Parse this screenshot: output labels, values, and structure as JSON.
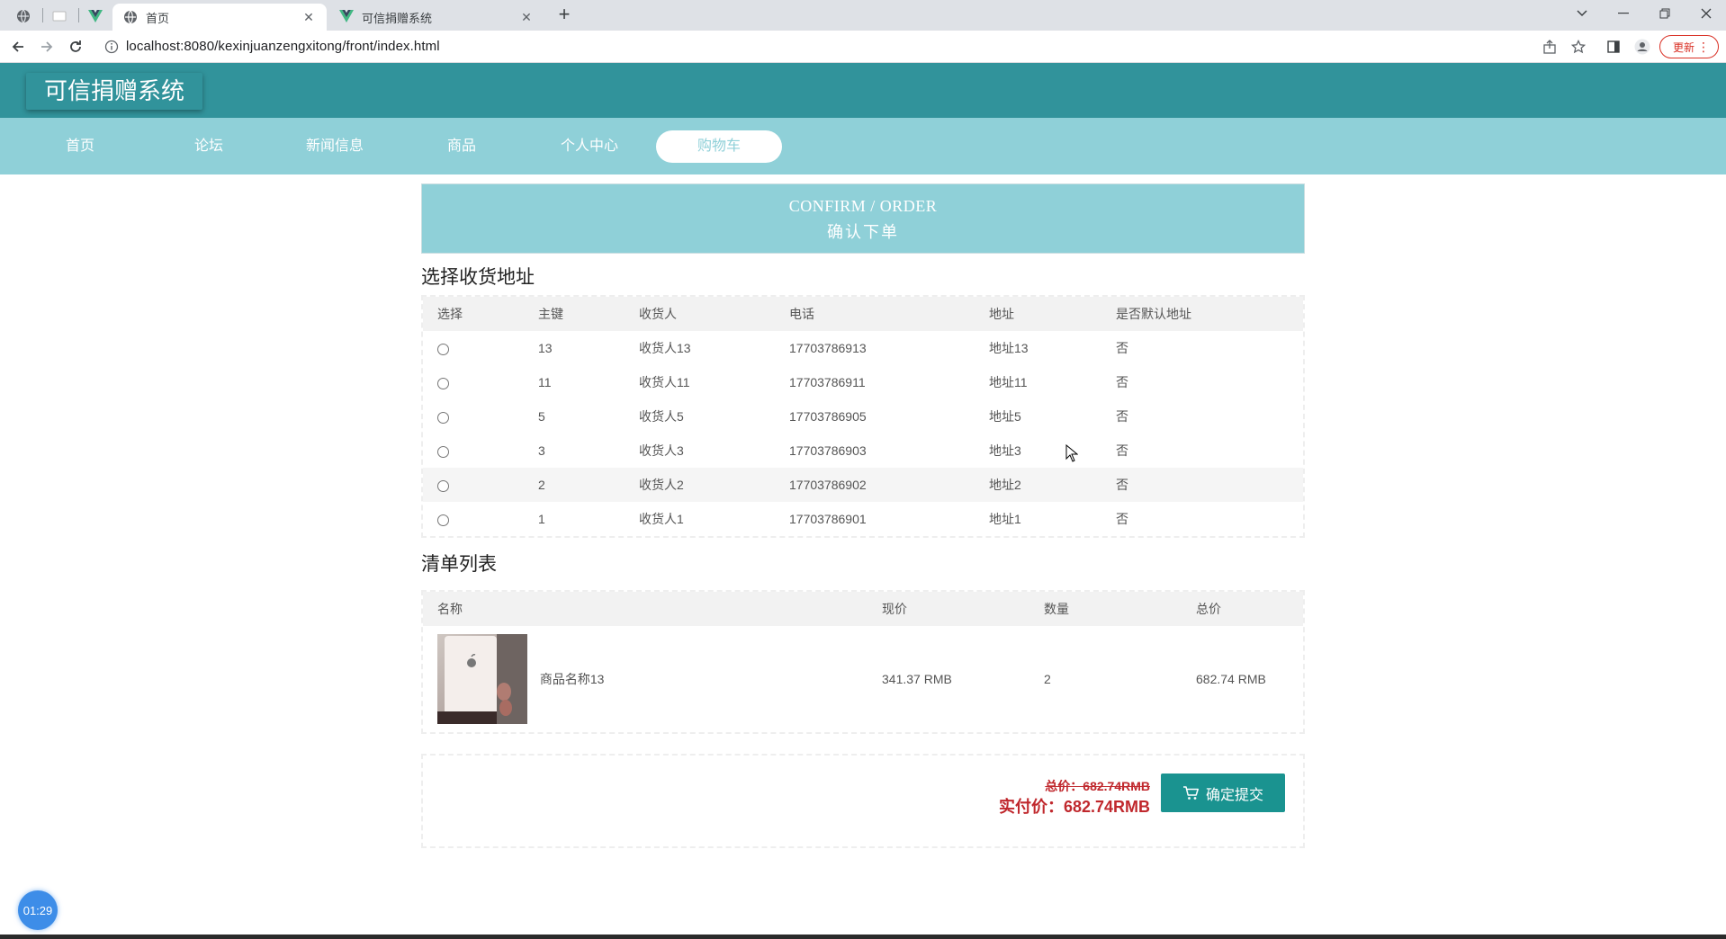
{
  "browser": {
    "tabs": [
      {
        "title": "首页",
        "active": true
      },
      {
        "title": "可信捐赠系统",
        "active": false
      }
    ],
    "url": "localhost:8080/kexinjuanzengxitong/front/index.html",
    "update_label": "更新",
    "icons": [
      "back-icon",
      "forward-icon",
      "reload-icon",
      "info-icon",
      "share-icon",
      "star-icon",
      "sidepanel-icon",
      "profile-icon",
      "menu-icon"
    ]
  },
  "site": {
    "title": "可信捐赠系统",
    "nav": [
      "首页",
      "论坛",
      "新闻信息",
      "商品",
      "个人中心",
      "购物车"
    ],
    "active_nav": "购物车"
  },
  "banner": {
    "en": "CONFIRM / ORDER",
    "cn": "确认下单"
  },
  "address_section": {
    "title": "选择收货地址",
    "columns": [
      "选择",
      "主键",
      "收货人",
      "电话",
      "地址",
      "是否默认地址"
    ],
    "rows": [
      {
        "id": "13",
        "name": "收货人13",
        "phone": "17703786913",
        "address": "地址13",
        "default": "否"
      },
      {
        "id": "11",
        "name": "收货人11",
        "phone": "17703786911",
        "address": "地址11",
        "default": "否"
      },
      {
        "id": "5",
        "name": "收货人5",
        "phone": "17703786905",
        "address": "地址5",
        "default": "否"
      },
      {
        "id": "3",
        "name": "收货人3",
        "phone": "17703786903",
        "address": "地址3",
        "default": "否"
      },
      {
        "id": "2",
        "name": "收货人2",
        "phone": "17703786902",
        "address": "地址2",
        "default": "否"
      },
      {
        "id": "1",
        "name": "收货人1",
        "phone": "17703786901",
        "address": "地址1",
        "default": "否"
      }
    ]
  },
  "goods_section": {
    "title": "清单列表",
    "columns": [
      "名称",
      "现价",
      "数量",
      "总价"
    ],
    "rows": [
      {
        "name": "商品名称13",
        "price": "341.37 RMB",
        "qty": "2",
        "total": "682.74 RMB"
      }
    ]
  },
  "summary": {
    "total_label": "总价：682.74RMB",
    "actual_label": "实付价：682.74RMB",
    "submit_label": "确定提交"
  },
  "timer": "01:29",
  "colors": {
    "header": "#31939b",
    "nav": "#8fd0d8",
    "submit": "#1a9390",
    "price": "#c0282d"
  }
}
